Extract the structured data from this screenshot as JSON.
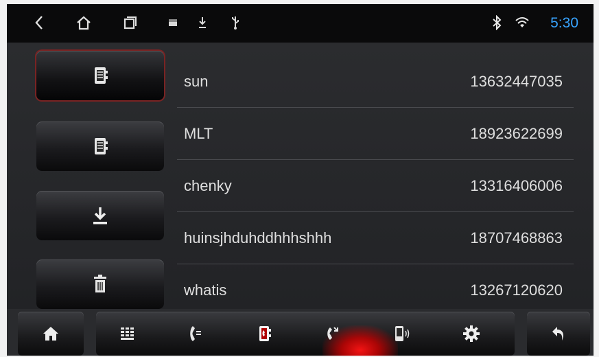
{
  "status_bar": {
    "icons": [
      "back-icon",
      "home-icon",
      "recent-apps-icon",
      "notification-icon",
      "download-icon",
      "usb-icon",
      "bluetooth-icon",
      "wifi-icon"
    ],
    "time": "5:30",
    "time_color": "#38a4ff"
  },
  "side_buttons": [
    {
      "icon": "phonebook-icon",
      "active": true
    },
    {
      "icon": "sim-contacts-icon",
      "active": false
    },
    {
      "icon": "download-contacts-icon",
      "active": false
    },
    {
      "icon": "delete-icon",
      "active": false
    }
  ],
  "contacts": [
    {
      "name": "sun",
      "number": "13632447035"
    },
    {
      "name": "MLT",
      "number": "18923622699"
    },
    {
      "name": "chenky",
      "number": "13316406006"
    },
    {
      "name": "huinsjhduhddhhhshhh",
      "number": "18707468863"
    },
    {
      "name": "whatis",
      "number": "13267120620"
    }
  ],
  "bottom_nav": {
    "items": [
      "home-icon",
      "dialpad-icon",
      "call-log-icon",
      "contacts-icon",
      "call-transfer-icon",
      "device-audio-icon",
      "settings-icon",
      "return-icon"
    ],
    "active": "contacts-icon",
    "active_color": "#ff1a1a"
  }
}
